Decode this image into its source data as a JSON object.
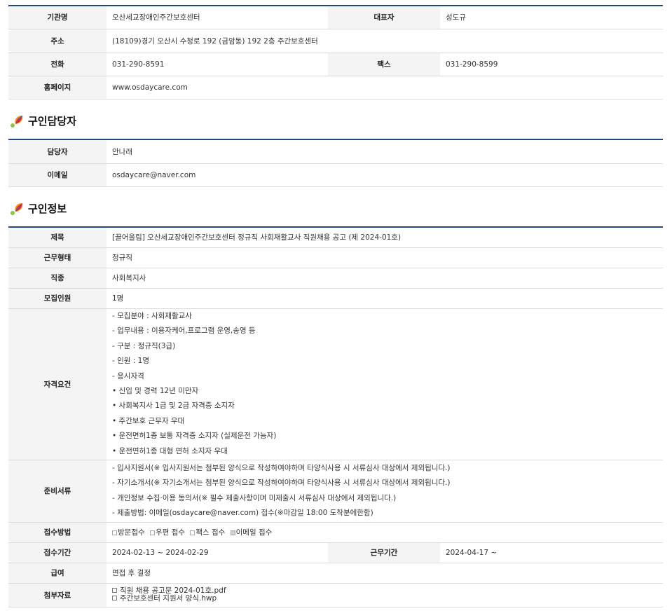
{
  "org": {
    "name_label": "기관명",
    "name": "오산세교장애인주간보호센터",
    "rep_label": "대표자",
    "rep": "성도규",
    "addr_label": "주소",
    "addr": "(18109)경기 오산시 수청로 192 (금암동) 192 2층 주간보호센터",
    "tel_label": "전화",
    "tel": "031-290-8591",
    "fax_label": "팩스",
    "fax": "031-290-8599",
    "home_label": "홈페이지",
    "home": "www.osdaycare.com"
  },
  "contact_section": {
    "title": "구인담당자",
    "icon": "colorful-leaf-icon"
  },
  "contact": {
    "person_label": "담당자",
    "person": "안나래",
    "email_label": "이메일",
    "email": "osdaycare@naver.com"
  },
  "job_section": {
    "title": "구인정보",
    "icon": "colorful-leaf-icon"
  },
  "job": {
    "title_label": "제목",
    "title": "[끌어올림] 오산세교장애인주간보호센터 정규직 사회재활교사 직원채용 공고 (제 2024-01호)",
    "worktype_label": "근무형태",
    "worktype": "정규직",
    "occupation_label": "직종",
    "occupation": "사회복지사",
    "headcount_label": "모집인원",
    "headcount": "1명",
    "qual_label": "자격요건",
    "qualifications": [
      "- 모집분야 : 사회재활교사",
      "- 업무내용 : 이용자케어,프로그램 운영,송영 등",
      "- 구분 : 정규직(3급)",
      "- 인원 : 1명",
      "- 응시자격",
      "• 신입 및 경력 12년 미만자",
      "• 사회복지사 1급 및 2급 자격증 소지자",
      "• 주간보호 근무자 우대",
      "• 운전면허1종 보통 자격증 소지자 (실제운전 가능자)",
      "• 운전면허1종 대형 면허 소지자 우대"
    ],
    "docs_label": "준비서류",
    "documents": [
      "- 입사지원서(※ 입사지원서는 첨부된 양식으로 작성하여야하며 타양식사용 시 서류심사 대상에서 제외됩니다.)",
      "- 자기소개서(※ 자기소개서는 첨부된 양식으로 작성하여야하며 타양식사용 시 서류심사 대상에서 제외됩니다.)",
      "- 개인정보 수집·이용 동의서(※ 필수 제출사항이며 미제출시 서류심사 대상에서 제외됩니다.)",
      "- 제출방법: 이메일(osdaycare@naver.com) 접수(※마감일 18:00 도착분에한함)"
    ],
    "method_label": "접수방법",
    "methods": [
      {
        "label": "방문접수",
        "checked": false
      },
      {
        "label": "우편 접수",
        "checked": false
      },
      {
        "label": "팩스 접수",
        "checked": false
      },
      {
        "label": "이메일 접수",
        "checked": true
      }
    ],
    "period_label": "접수기간",
    "period": "2024-02-13 ~ 2024-02-29",
    "workperiod_label": "근무기간",
    "workperiod": "2024-04-17 ~",
    "salary_label": "급여",
    "salary": "면접 후 결정",
    "attach_label": "첨부자료",
    "attachments": [
      "직원 채용 공고문 2024-01호.pdf",
      "주간보호센터 지원서 양식.hwp"
    ]
  },
  "colors": {
    "header_line": "#24477f",
    "label_bg": "#f4f4f4",
    "border": "#dcdcdc"
  }
}
